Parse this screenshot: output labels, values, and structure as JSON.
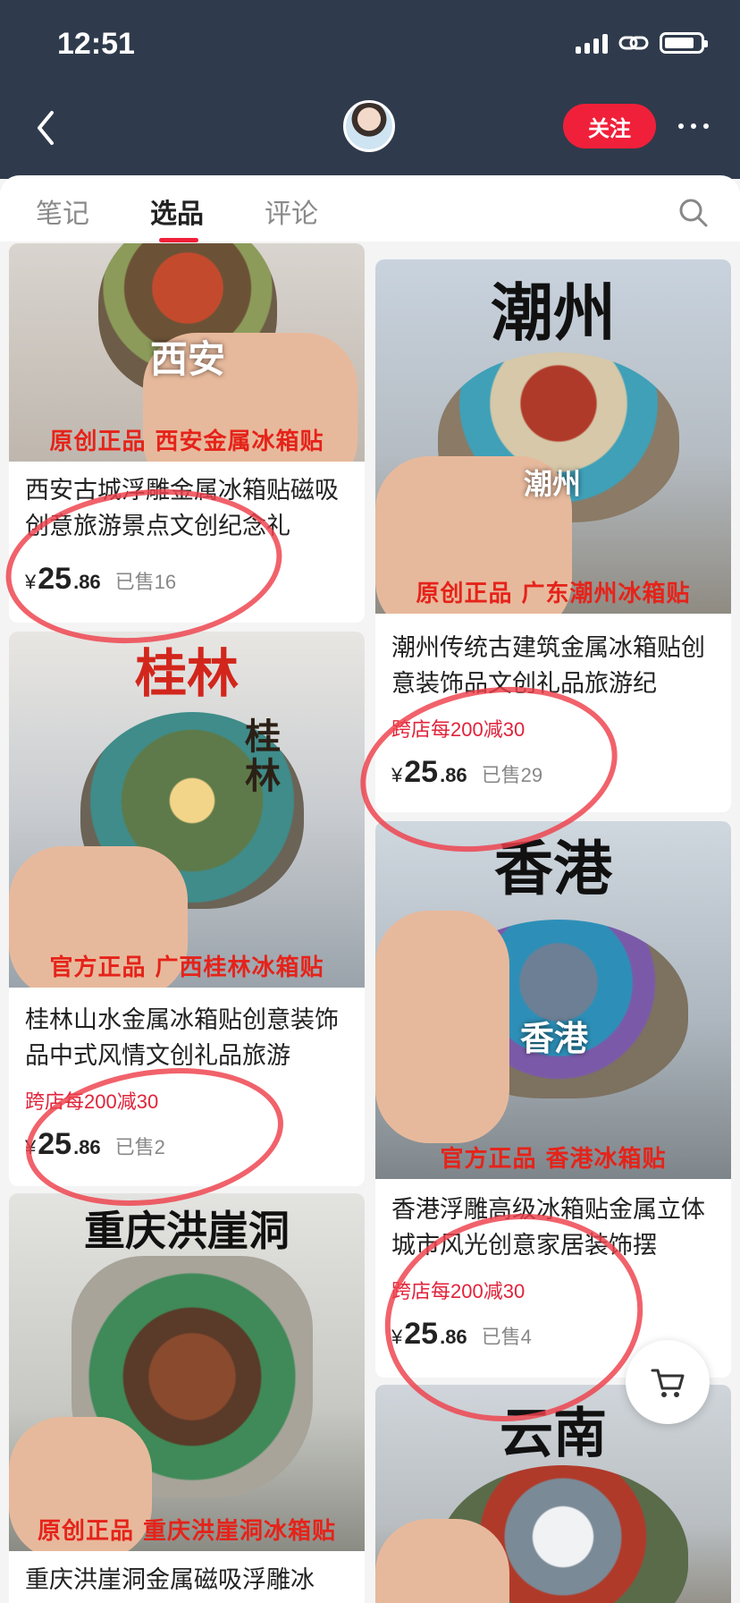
{
  "status_bar": {
    "time": "12:51"
  },
  "header": {
    "follow_label": "关注"
  },
  "tabs": [
    {
      "label": "笔记",
      "active": false
    },
    {
      "label": "选品",
      "active": true
    },
    {
      "label": "评论",
      "active": false
    }
  ],
  "products": [
    {
      "image_overlay": "原创正品 西安金属冰箱贴",
      "magnet_text": "西安",
      "title": "西安古城浮雕金属冰箱贴磁吸创意旅游景点文创纪念礼",
      "price_currency": "¥",
      "price_int": "25",
      "price_dec": ".86",
      "sold": "已售16"
    },
    {
      "image_title": "潮州",
      "image_overlay": "原创正品  广东潮州冰箱贴",
      "magnet_text": "潮州",
      "title": "潮州传统古建筑金属冰箱贴创意装饰品文创礼品旅游纪",
      "promo": "跨店每200减30",
      "price_currency": "¥",
      "price_int": "25",
      "price_dec": ".86",
      "sold": "已售29"
    },
    {
      "image_title": "桂林",
      "image_overlay": "官方正品 广西桂林冰箱贴",
      "magnet_text": "桂林",
      "title": "桂林山水金属冰箱贴创意装饰品中式风情文创礼品旅游",
      "promo": "跨店每200减30",
      "price_currency": "¥",
      "price_int": "25",
      "price_dec": ".86",
      "sold": "已售2"
    },
    {
      "image_title": "香港",
      "image_overlay": "官方正品 香港冰箱贴",
      "magnet_text": "香港",
      "title": "香港浮雕高级冰箱贴金属立体城市风光创意家居装饰摆",
      "promo": "跨店每200减30",
      "price_currency": "¥",
      "price_int": "25",
      "price_dec": ".86",
      "sold": "已售4"
    },
    {
      "image_title": "重庆洪崖洞",
      "image_overlay": "原创正品 重庆洪崖洞冰箱贴",
      "title": "重庆洪崖洞金属磁吸浮雕冰"
    },
    {
      "image_title": "云南"
    }
  ],
  "icons": [
    "back-icon",
    "search-icon",
    "cart-icon",
    "more-icon"
  ],
  "colors": {
    "header_bg": "#2f3b4c",
    "accent": "#f0203a",
    "promo": "#e0233a",
    "price_text": "#222222"
  }
}
